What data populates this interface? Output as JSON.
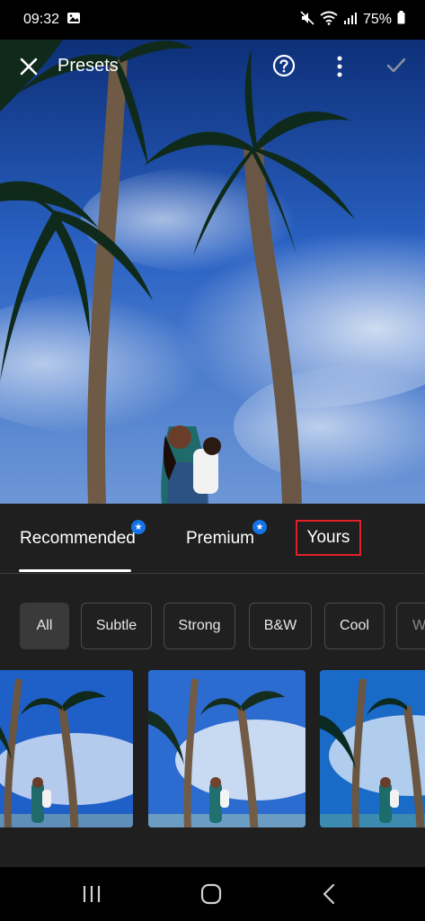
{
  "status_bar": {
    "time": "09:32",
    "battery": "75%"
  },
  "toolbar": {
    "title": "Presets",
    "close_icon": "close-icon",
    "help_icon": "help-circle-icon",
    "more_icon": "more-vertical-icon",
    "apply_icon": "check-icon"
  },
  "tabs": [
    {
      "label": "Recommended",
      "badge": "premium-star-icon",
      "selected": true
    },
    {
      "label": "Premium",
      "badge": "premium-star-icon",
      "selected": false
    },
    {
      "label": "Yours",
      "badge": null,
      "selected": false
    }
  ],
  "chips": [
    {
      "label": "All",
      "active": true
    },
    {
      "label": "Subtle",
      "active": false
    },
    {
      "label": "Strong",
      "active": false
    },
    {
      "label": "B&W",
      "active": false
    },
    {
      "label": "Cool",
      "active": false
    },
    {
      "label": "W",
      "active": false
    }
  ],
  "colors": {
    "accent_blue": "#1473e6",
    "highlight_red": "#e2202a",
    "panel_bg": "#202020"
  },
  "navigation": {
    "recents_icon": "recents-icon",
    "home_icon": "home-icon",
    "back_icon": "back-icon"
  }
}
